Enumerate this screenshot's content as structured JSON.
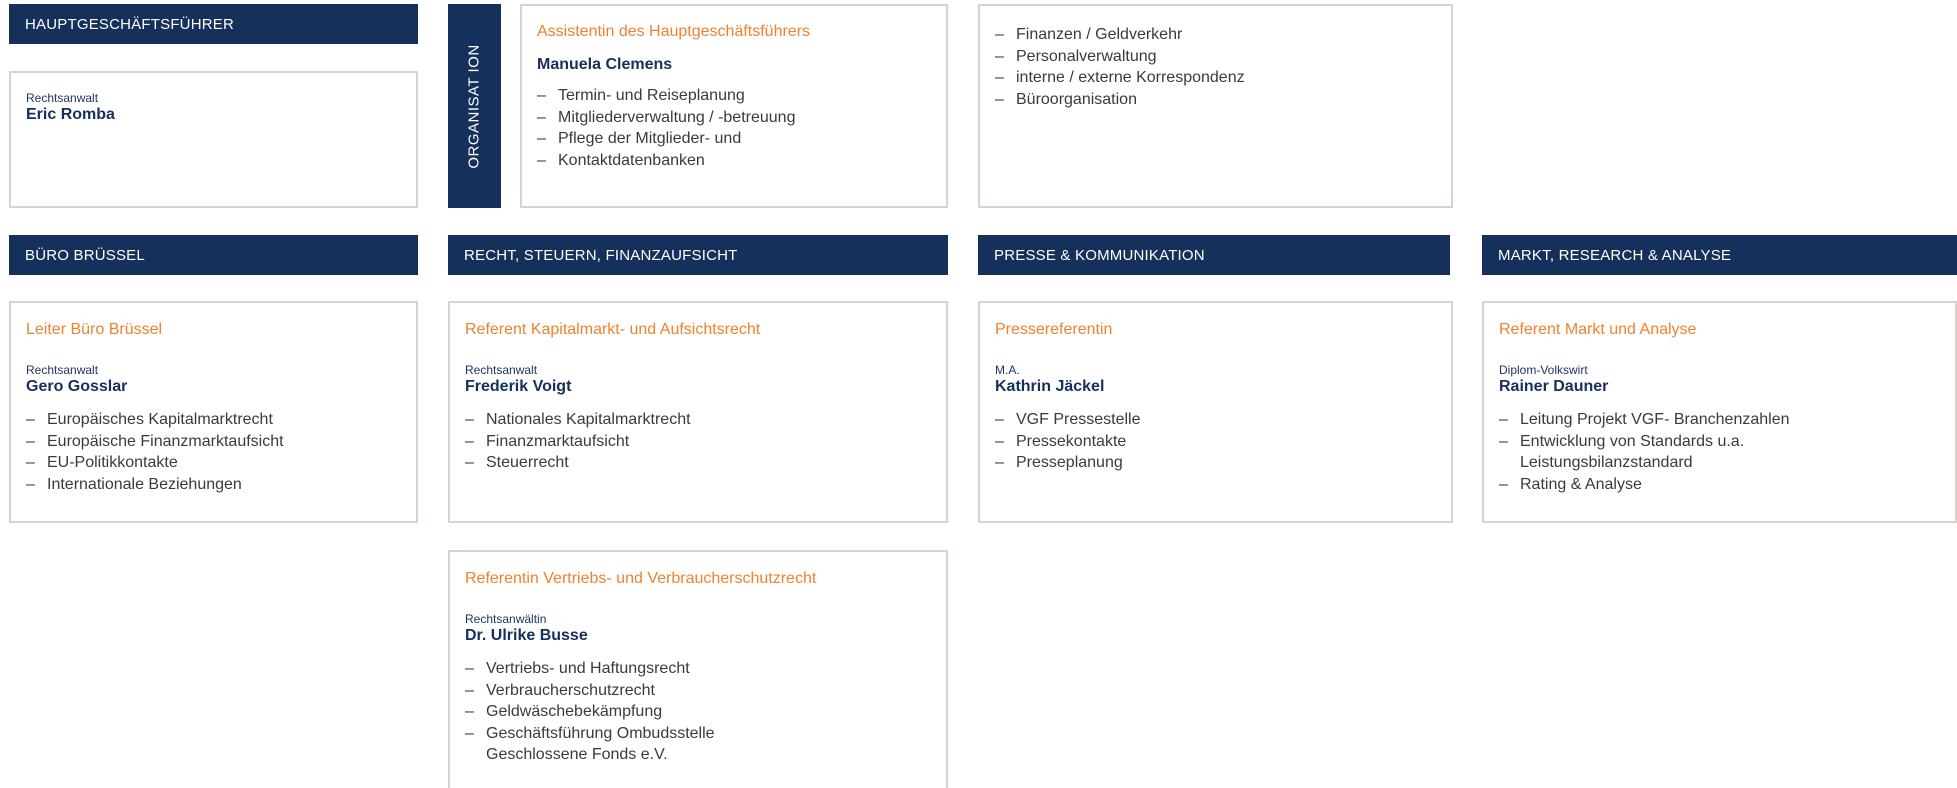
{
  "hgf": {
    "header": "HAUPTGESCHÄFTSFÜHRER",
    "person_title": "Rechtsanwalt",
    "person_name": "Eric Romba"
  },
  "organisation": {
    "vertical_label": "ORGANISAT ION",
    "role": "Assistentin des Hauptgeschäftsführers",
    "person_name": "Manuela Clemens",
    "duties": [
      "Termin- und Reiseplanung",
      "Mitgliederverwaltung / -betreuung",
      "Pflege der Mitglieder- und",
      "Kontaktdatenbanken"
    ],
    "duties_more": [
      "Finanzen / Geldverkehr",
      "Personalverwaltung",
      "interne / externe Korrespondenz",
      "Büroorganisation"
    ]
  },
  "departments": [
    {
      "header": "BÜRO BRÜSSEL",
      "role": "Leiter Büro Brüssel",
      "person_title": "Rechtsanwalt",
      "person_name": "Gero Gosslar",
      "duties": [
        "Europäisches Kapitalmarktrecht",
        "Europäische Finanzmarktaufsicht",
        "EU-Politikkontakte",
        "Internationale Beziehungen"
      ]
    },
    {
      "header": "RECHT, STEUERN, FINANZAUFSICHT",
      "role": "Referent Kapitalmarkt- und Aufsichtsrecht",
      "person_title": "Rechtsanwalt",
      "person_name": "Frederik Voigt",
      "duties": [
        "Nationales Kapitalmarktrecht",
        "Finanzmarktaufsicht",
        "Steuerrecht"
      ]
    },
    {
      "header": "PRESSE & KOMMUNIKATION",
      "role": "Pressereferentin",
      "person_title": "M.A.",
      "person_name": "Kathrin Jäckel",
      "duties": [
        "VGF Pressestelle",
        "Pressekontakte",
        "Presseplanung"
      ]
    },
    {
      "header": "MARKT, RESEARCH & ANALYSE",
      "role": "Referent Markt und Analyse",
      "person_title": "Diplom-Volkswirt",
      "person_name": "Rainer Dauner",
      "duties": [
        "Leitung Projekt VGF- Branchenzahlen",
        "Entwicklung von Standards u.a. Leistungsbilanzstandard",
        "Rating & Analyse"
      ]
    }
  ],
  "extra": {
    "role": "Referentin Vertriebs- und Verbraucherschutzrecht",
    "person_title": "Rechtsanwältin",
    "person_name": "Dr. Ulrike Busse",
    "duties": [
      "Vertriebs- und Haftungsrecht",
      "Verbraucherschutzrecht",
      "Geldwäschebekämpfung",
      "Geschäftsführung Ombudsstelle Geschlossene Fonds e.V."
    ]
  },
  "colors": {
    "navy": "#15305a",
    "accent_orange": "#f0822d",
    "border": "#d8d4cc"
  }
}
